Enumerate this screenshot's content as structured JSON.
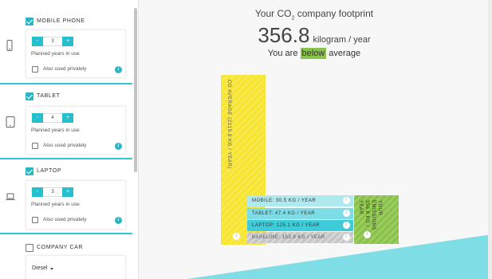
{
  "devices": [
    {
      "label": "MOBILE PHONE",
      "checked": true,
      "icon": "phone-icon",
      "years_value": "3",
      "minus": "-",
      "plus": "+",
      "planned_label": "Planned years in use",
      "private_label": "Also used privately",
      "info": "i"
    },
    {
      "label": "TABLET",
      "checked": true,
      "icon": "tablet-icon",
      "years_value": "4",
      "minus": "-",
      "plus": "+",
      "planned_label": "Planned years in use",
      "private_label": "Also used privately",
      "info": "i"
    },
    {
      "label": "LAPTOP",
      "checked": true,
      "icon": "laptop-icon",
      "years_value": "3",
      "minus": "-",
      "plus": "+",
      "planned_label": "Planned years in use",
      "private_label": "Also used privately",
      "info": "i"
    },
    {
      "label": "COMPANY CAR",
      "checked": false,
      "fuel_value": "Diesel"
    }
  ],
  "summary": {
    "title_prefix": "Your CO",
    "title_sub": "2",
    "title_suffix": " company footprint",
    "value": "356.8",
    "unit": "kilogram / year",
    "avg_prefix": "You are ",
    "avg_highlight": "below",
    "avg_suffix": " average"
  },
  "chart_data": {
    "type": "bar",
    "average": {
      "label": "CO AVERAGE (2215.8 KG / YEAR)",
      "value": 2215.8
    },
    "breakdown": [
      {
        "label": "MOBILE: 30.5 KG / YEAR",
        "value": 30.5
      },
      {
        "label": "TABLET: 47.4 KG / YEAR",
        "value": 47.4
      },
      {
        "label": "LAPTOP: 125.1 KG / YEAR",
        "value": 125.1
      },
      {
        "label": "BASELINE: 153.9 KG / YEAR",
        "value": 153.9
      }
    ],
    "yours": {
      "label": "YOUR\nEMISSIONS\n356.8 KG /\nYEAR",
      "value": 356.8
    },
    "info": "i"
  },
  "colors": {
    "accent": "#26bfcf",
    "average_bar": "#f7e532",
    "your_bar": "#8bc34a",
    "highlight": "#8bc34a"
  }
}
